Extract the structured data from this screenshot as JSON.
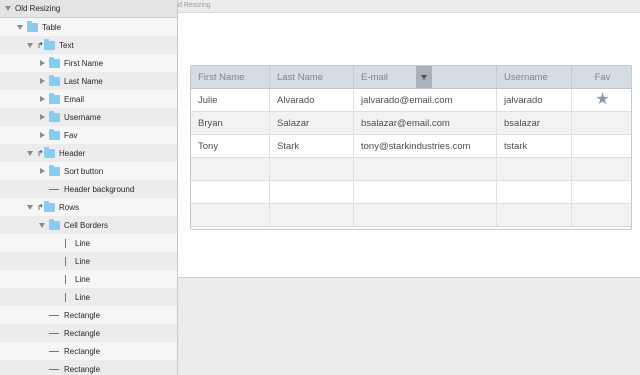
{
  "layers": {
    "items": [
      {
        "label": "Old Resizing",
        "expand": "down",
        "kind": "none",
        "level": 0
      },
      {
        "label": "Table",
        "expand": "down",
        "kind": "folder",
        "level": 1
      },
      {
        "label": "Text",
        "expand": "down",
        "kind": "mask-folder",
        "level": 2
      },
      {
        "label": "First Name",
        "expand": "right",
        "kind": "folder",
        "level": 3
      },
      {
        "label": "Last Name",
        "expand": "right",
        "kind": "folder",
        "level": 3
      },
      {
        "label": "Email",
        "expand": "right",
        "kind": "folder",
        "level": 3
      },
      {
        "label": "Username",
        "expand": "right",
        "kind": "folder",
        "level": 3
      },
      {
        "label": "Fav",
        "expand": "right",
        "kind": "folder",
        "level": 3
      },
      {
        "label": "Header",
        "expand": "down",
        "kind": "mask-folder",
        "level": 2
      },
      {
        "label": "Sort button",
        "expand": "right",
        "kind": "folder",
        "level": 3
      },
      {
        "label": "Header background",
        "expand": "none",
        "kind": "hline",
        "level": 3
      },
      {
        "label": "Rows",
        "expand": "down",
        "kind": "mask-folder",
        "level": 2
      },
      {
        "label": "Cell Borders",
        "expand": "down",
        "kind": "folder",
        "level": 3
      },
      {
        "label": "Line",
        "expand": "none",
        "kind": "vline",
        "level": 4
      },
      {
        "label": "Line",
        "expand": "none",
        "kind": "vline",
        "level": 4
      },
      {
        "label": "Line",
        "expand": "none",
        "kind": "vline",
        "level": 4
      },
      {
        "label": "Line",
        "expand": "none",
        "kind": "vline",
        "level": 4
      },
      {
        "label": "Rectangle",
        "expand": "none",
        "kind": "hline",
        "level": 3
      },
      {
        "label": "Rectangle",
        "expand": "none",
        "kind": "hline",
        "level": 3
      },
      {
        "label": "Rectangle",
        "expand": "none",
        "kind": "hline",
        "level": 3
      },
      {
        "label": "Rectangle",
        "expand": "none",
        "kind": "hline",
        "level": 3
      }
    ]
  },
  "canvas": {
    "artboard_label": "d Resizing"
  },
  "table": {
    "headers": [
      "First Name",
      "Last Name",
      "E-mail",
      "Username",
      "Fav"
    ],
    "rows": [
      [
        "Julie",
        "Alvarado",
        "jalvarado@email.com",
        "jalvarado",
        "star-icon"
      ],
      [
        "Bryan",
        "Salazar",
        "bsalazar@email.com",
        "bsalazar",
        ""
      ],
      [
        "Tony",
        "Stark",
        "tony@starkindustries.com",
        "tstark",
        ""
      ],
      [
        "",
        "",
        "",
        "",
        ""
      ],
      [
        "",
        "",
        "",
        "",
        ""
      ],
      [
        "",
        "",
        "",
        "",
        ""
      ]
    ],
    "star_glyph": "★",
    "colors": {
      "header_bg": "#d6dce3",
      "folder": "#88ccef",
      "star": "#8d9aaa"
    }
  }
}
